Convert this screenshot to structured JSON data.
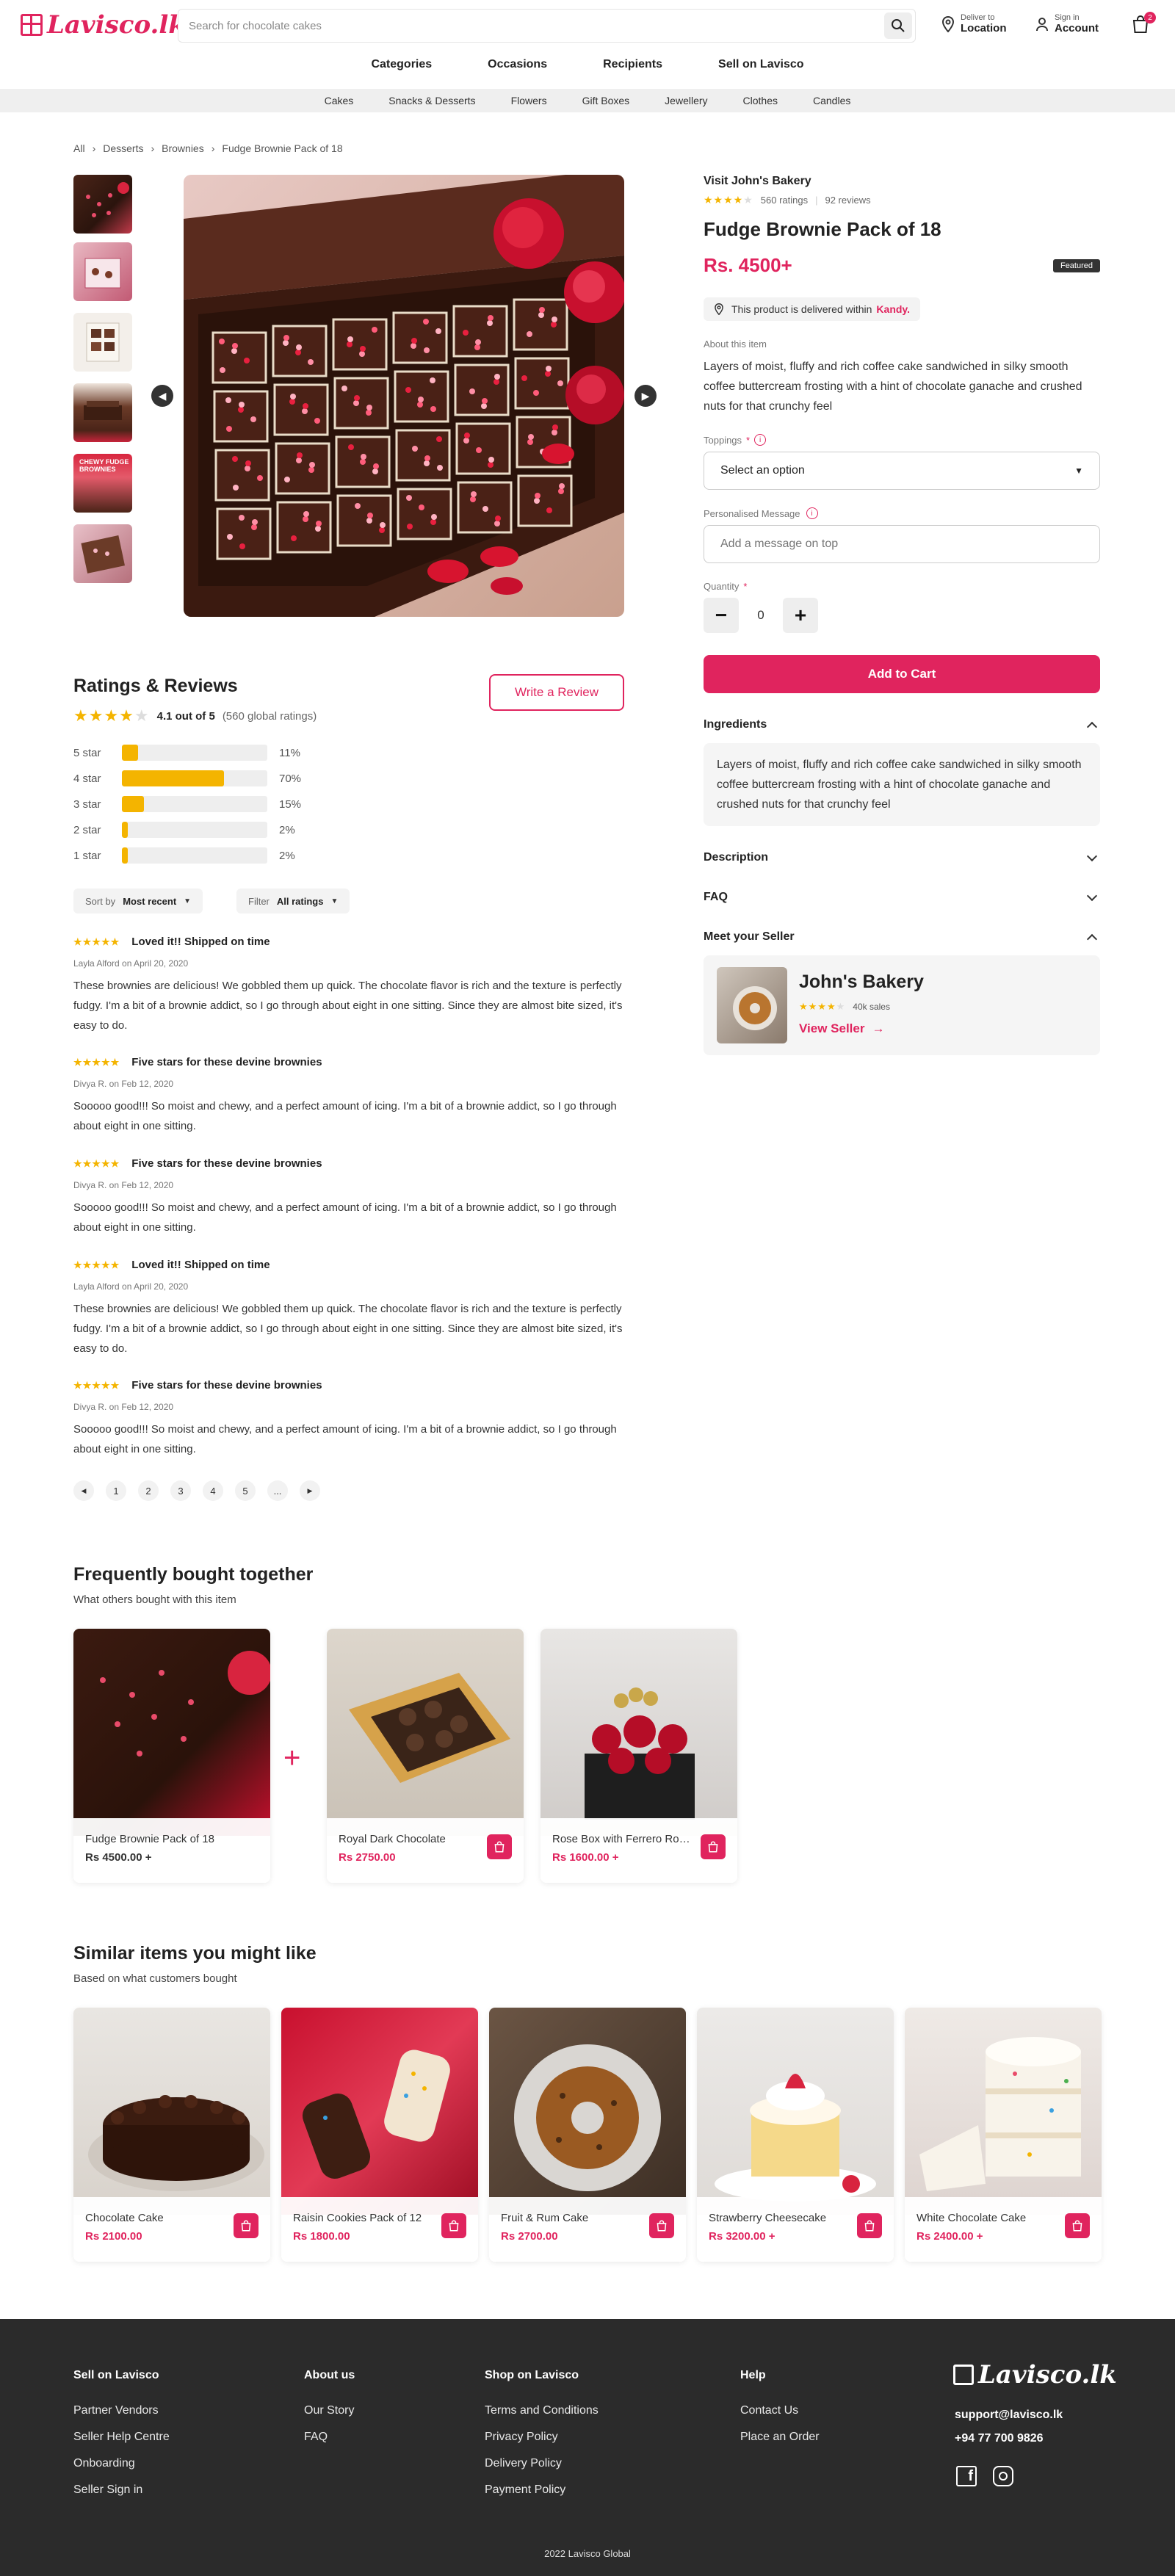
{
  "header": {
    "logo_text": "Lavisco.lk",
    "search_placeholder": "Search for chocolate cakes",
    "deliver_small": "Deliver to",
    "deliver_big": "Location",
    "signin_small": "Sign in",
    "signin_big": "Account",
    "cart_count": "2"
  },
  "nav": {
    "main": [
      "Categories",
      "Occasions",
      "Recipients",
      "Sell on Lavisco"
    ],
    "sub": [
      "Cakes",
      "Snacks & Desserts",
      "Flowers",
      "Gift Boxes",
      "Jewellery",
      "Clothes",
      "Candles"
    ]
  },
  "breadcrumb": [
    "All",
    "Desserts",
    "Brownies",
    "Fudge Brownie Pack of 18"
  ],
  "product": {
    "seller_link": "Visit John's Bakery",
    "ratings_count": "560 ratings",
    "reviews_count": "92 reviews",
    "title": "Fudge Brownie Pack of 18",
    "price": "Rs. 4500+",
    "badge": "Featured",
    "delivery_text": "This product is delivered within",
    "delivery_city": "Kandy.",
    "about_label": "About this item",
    "about_text": "Layers of moist, fluffy and rich coffee cake sandwiched in silky smooth coffee buttercream frosting with a hint of chocolate ganache and crushed nuts for that crunchy feel",
    "toppings_label": "Toppings",
    "toppings_value": "Select an option",
    "message_label": "Personalised Message",
    "message_placeholder": "Add a message on top",
    "quantity_label": "Quantity",
    "quantity_value": "0",
    "add_to_cart": "Add to Cart",
    "ingredients_label": "Ingredients",
    "ingredients_text": "Layers of moist, fluffy and rich coffee cake sandwiched in silky smooth coffee buttercream frosting with a hint of chocolate ganache and crushed nuts for that crunchy feel",
    "description_label": "Description",
    "faq_label": "FAQ",
    "meet_seller_label": "Meet your Seller",
    "seller_name": "John's Bakery",
    "seller_sales": "40k sales",
    "view_seller": "View Seller",
    "rating_stars": 4
  },
  "ratings": {
    "heading": "Ratings & Reviews",
    "write_review": "Write a Review",
    "summary": "4.1 out of 5",
    "global": "(560 global ratings)",
    "bars": [
      {
        "label": "5 star",
        "pct": "11%",
        "value": 0.11
      },
      {
        "label": "4 star",
        "pct": "70%",
        "value": 0.7
      },
      {
        "label": "3 star",
        "pct": "15%",
        "value": 0.15
      },
      {
        "label": "2 star",
        "pct": "2%",
        "value": 0.02
      },
      {
        "label": "1 star",
        "pct": "2%",
        "value": 0.02
      }
    ],
    "sort_label": "Sort by",
    "sort_value": "Most recent",
    "filter_label": "Filter",
    "filter_value": "All ratings"
  },
  "reviews": [
    {
      "title": "Loved it!! Shipped on time",
      "meta": "Layla Alford on April 20, 2020",
      "body": "These brownies are delicious! We gobbled them up quick. The chocolate flavor is rich and the texture is perfectly fudgy. I'm a bit of a brownie addict, so I go through about eight in one sitting. Since they are almost bite sized, it's easy to do."
    },
    {
      "title": "Five stars for these devine brownies",
      "meta": "Divya R. on Feb 12, 2020",
      "body": "Sooooo good!!! So moist and chewy, and a perfect amount of icing. I'm a bit of a brownie addict, so I go through about eight in one sitting."
    },
    {
      "title": "Five stars for these devine brownies",
      "meta": "Divya R. on Feb 12, 2020",
      "body": "Sooooo good!!! So moist and chewy, and a perfect amount of icing. I'm a bit of a brownie addict, so I go through about eight in one sitting."
    },
    {
      "title": "Loved it!! Shipped on time",
      "meta": "Layla Alford on April 20, 2020",
      "body": "These brownies are delicious! We gobbled them up quick. The chocolate flavor is rich and the texture is perfectly fudgy. I'm a bit of a brownie addict, so I go through about eight in one sitting. Since they are almost bite sized, it's easy to do."
    },
    {
      "title": "Five stars for these devine brownies",
      "meta": "Divya R. on Feb 12, 2020",
      "body": "Sooooo good!!! So moist and chewy, and a perfect amount of icing. I'm a bit of a brownie addict, so I go through about eight in one sitting."
    }
  ],
  "pagination": [
    "1",
    "2",
    "3",
    "4",
    "5",
    "..."
  ],
  "fbt": {
    "heading": "Frequently bought together",
    "subheading": "What others bought with this item",
    "items": [
      {
        "name": "Fudge Brownie Pack of 18",
        "price": "Rs 4500.00 +"
      },
      {
        "name": "Royal Dark Chocolate",
        "price": "Rs 2750.00"
      },
      {
        "name": "Rose Box with Ferrero Rocher",
        "price": "Rs 1600.00 +"
      }
    ]
  },
  "similar": {
    "heading": "Similar items you might like",
    "subheading": "Based on what customers bought",
    "items": [
      {
        "name": "Chocolate Cake",
        "price": "Rs 2100.00"
      },
      {
        "name": "Raisin Cookies Pack of 12",
        "price": "Rs 1800.00"
      },
      {
        "name": "Fruit & Rum Cake",
        "price": "Rs 2700.00"
      },
      {
        "name": "Strawberry Cheesecake",
        "price": "Rs 3200.00 +"
      },
      {
        "name": "White Chocolate Cake",
        "price": "Rs 2400.00 +"
      }
    ]
  },
  "footer": {
    "col1": {
      "title": "Sell on Lavisco",
      "links": [
        "Partner Vendors",
        "Seller Help Centre",
        "Onboarding",
        "Seller Sign in"
      ]
    },
    "col2": {
      "title": "About us",
      "links": [
        "Our Story",
        "FAQ"
      ]
    },
    "col3": {
      "title": "Shop on Lavisco",
      "links": [
        "Terms and Conditions",
        "Privacy Policy",
        "Delivery Policy",
        "Payment Policy"
      ]
    },
    "col4": {
      "title": "Help",
      "links": [
        "Contact Us",
        "Place an Order"
      ]
    },
    "logo_text": "Lavisco.lk",
    "email": "support@lavisco.lk",
    "phone": "+94 77 700 9826",
    "copyright": "2022 Lavisco Global"
  },
  "colors": {
    "accent": "#e0245e",
    "star": "#f4b400",
    "footer_bg": "#2b2b2b"
  }
}
